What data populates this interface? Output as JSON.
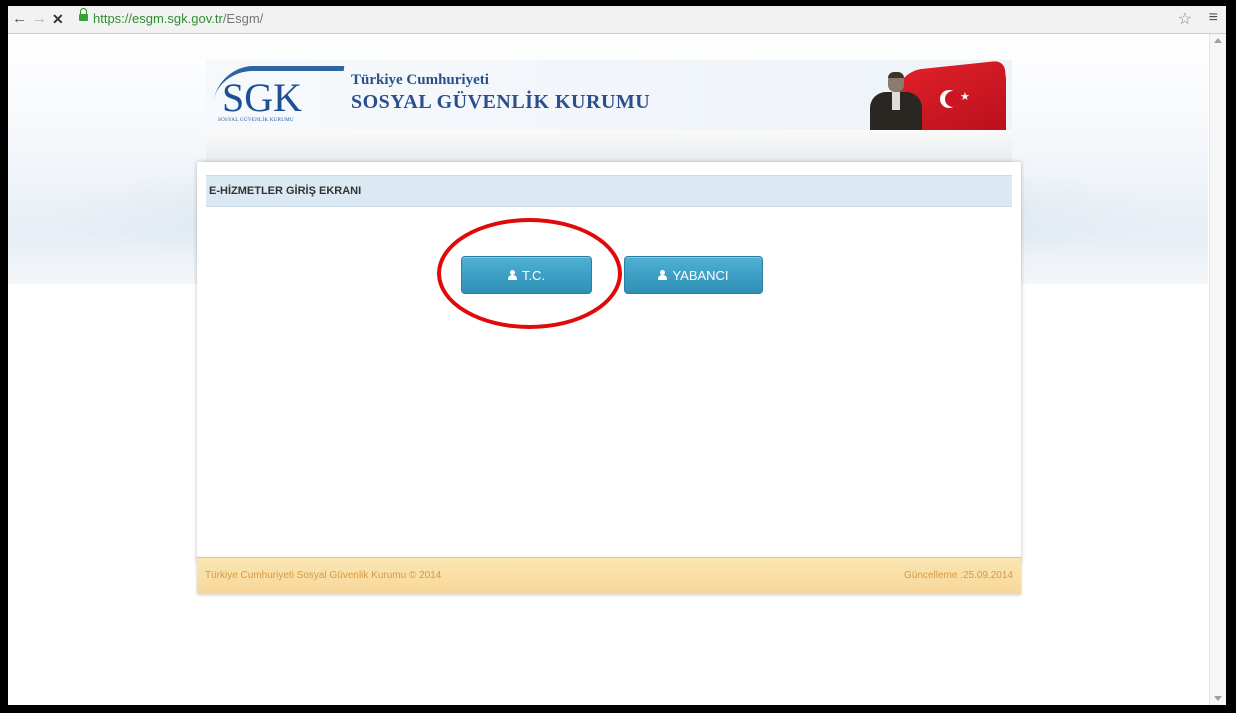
{
  "browser": {
    "back_icon": "←",
    "forward_icon": "→",
    "stop_icon": "✕",
    "url_host": "https://esgm.sgk.gov.tr",
    "url_path": "/Esgm/",
    "star_icon": "☆",
    "menu_icon": "≡"
  },
  "header": {
    "logo_text": "SGK",
    "logo_subtext": "SOSYAL GÜVENLİK KURUMU",
    "org_line1": "Türkiye Cumhuriyeti",
    "org_line2": "SOSYAL GÜVENLİK KURUMU"
  },
  "panel": {
    "title": "E-HİZMETLER GİRİŞ EKRANI",
    "buttons": {
      "tc_label": "T.C.",
      "foreign_label": "YABANCI"
    }
  },
  "footer": {
    "left": "Türkiye Cumhuriyeti Sosyal Güvenlik Kurumu © 2014",
    "right": "Güncelleme :25.09.2014"
  },
  "colors": {
    "button": "#3a9fc4",
    "highlight": "#e10a0a",
    "title_bg": "#dbe9f3",
    "footer_bg": "#f9dfa5"
  }
}
